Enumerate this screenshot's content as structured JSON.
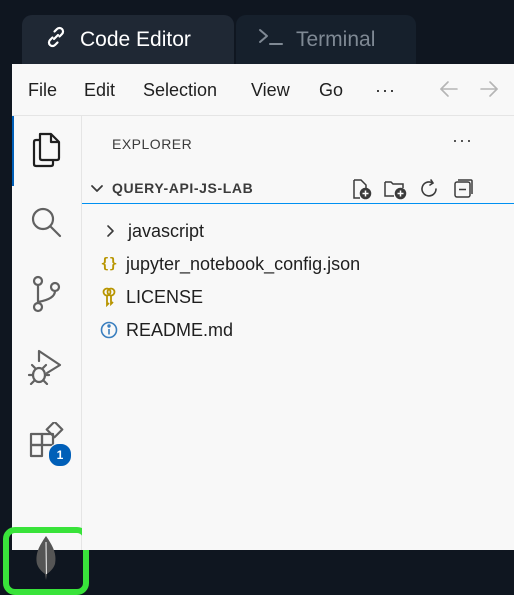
{
  "tabs": [
    {
      "label": "Code Editor",
      "icon": "link-icon",
      "active": true
    },
    {
      "label": "Terminal",
      "icon": "terminal-prompt-icon",
      "active": false
    }
  ],
  "menu": {
    "file": "File",
    "edit": "Edit",
    "selection": "Selection",
    "view": "View",
    "go": "Go",
    "more": "···"
  },
  "activity": {
    "explorer": "files-icon",
    "search": "search-icon",
    "source_control": "source-control-icon",
    "run_debug": "run-debug-icon",
    "extensions": "extensions-icon",
    "extensions_badge": "1",
    "mongodb": "mongodb-leaf-icon"
  },
  "explorer": {
    "title": "EXPLORER",
    "more": "···",
    "section_title": "QUERY-API-JS-LAB",
    "items": [
      {
        "label": "javascript",
        "icon": "chevron-right-icon"
      },
      {
        "label": "jupyter_notebook_config.json",
        "icon": "json-braces-icon",
        "glyph": "{}"
      },
      {
        "label": "LICENSE",
        "icon": "license-key-icon"
      },
      {
        "label": "README.md",
        "icon": "info-icon"
      }
    ]
  },
  "colors": {
    "accent": "#005fb8",
    "highlight": "#39e33a",
    "focus_border": "#0090f1",
    "json": "#b89500",
    "license": "#b89500"
  }
}
